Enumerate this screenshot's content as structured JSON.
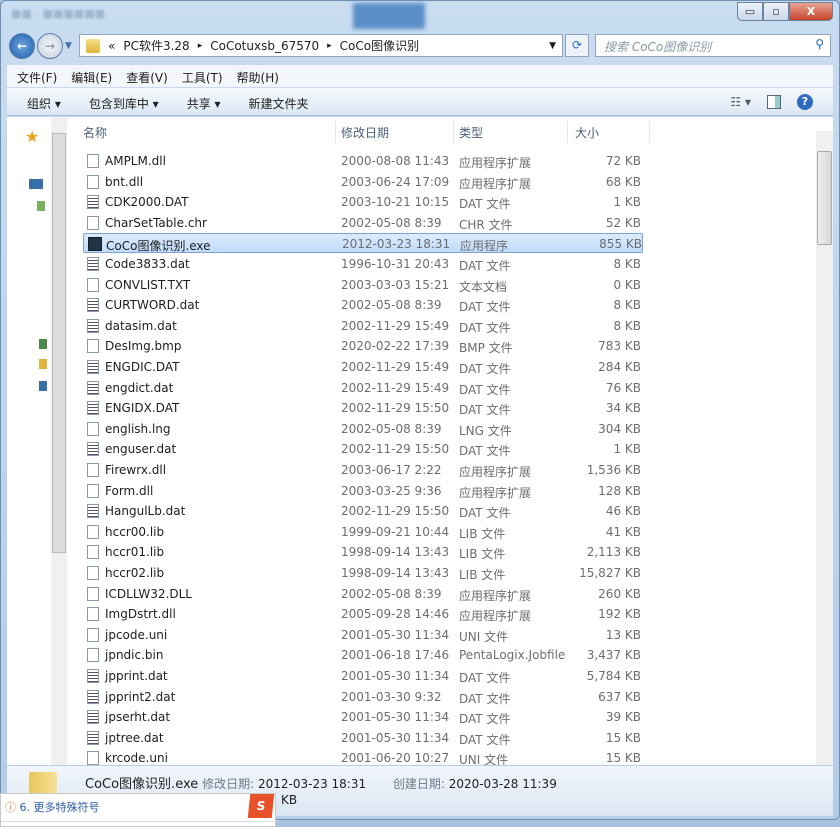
{
  "window": {
    "title_buttons": {
      "minimize": "▭",
      "maximize": "▫",
      "close": "X"
    }
  },
  "address": {
    "prefix": "«",
    "crumbs": [
      "PC软件3.28",
      "CoCotuxsb_67570",
      "CoCo图像识别"
    ],
    "separator": "▸"
  },
  "search": {
    "placeholder": "搜索 CoCo图像识别"
  },
  "menu": [
    "文件(F)",
    "编辑(E)",
    "查看(V)",
    "工具(T)",
    "帮助(H)"
  ],
  "toolbar": {
    "organize": "组织 ▾",
    "include": "包含到库中 ▾",
    "share": "共享 ▾",
    "new_folder": "新建文件夹",
    "help": "?"
  },
  "columns": {
    "name": "名称",
    "date": "修改日期",
    "type": "类型",
    "size": "大小"
  },
  "files": [
    {
      "name": "AMPLM.dll",
      "date": "2000-08-08 11:43",
      "type": "应用程序扩展",
      "size": "72 KB",
      "icon": "dll"
    },
    {
      "name": "bnt.dll",
      "date": "2003-06-24 17:09",
      "type": "应用程序扩展",
      "size": "68 KB",
      "icon": "dll"
    },
    {
      "name": "CDK2000.DAT",
      "date": "2003-10-21 10:15",
      "type": "DAT 文件",
      "size": "1 KB",
      "icon": "dat"
    },
    {
      "name": "CharSetTable.chr",
      "date": "2002-05-08 8:39",
      "type": "CHR 文件",
      "size": "52 KB",
      "icon": "file"
    },
    {
      "name": "CoCo图像识别.exe",
      "date": "2012-03-23 18:31",
      "type": "应用程序",
      "size": "855 KB",
      "icon": "exe",
      "selected": true
    },
    {
      "name": "Code3833.dat",
      "date": "1996-10-31 20:43",
      "type": "DAT 文件",
      "size": "8 KB",
      "icon": "dat"
    },
    {
      "name": "CONVLIST.TXT",
      "date": "2003-03-03 15:21",
      "type": "文本文档",
      "size": "0 KB",
      "icon": "file"
    },
    {
      "name": "CURTWORD.dat",
      "date": "2002-05-08 8:39",
      "type": "DAT 文件",
      "size": "8 KB",
      "icon": "dat"
    },
    {
      "name": "datasim.dat",
      "date": "2002-11-29 15:49",
      "type": "DAT 文件",
      "size": "8 KB",
      "icon": "dat"
    },
    {
      "name": "DesImg.bmp",
      "date": "2020-02-22 17:39",
      "type": "BMP 文件",
      "size": "783 KB",
      "icon": "file"
    },
    {
      "name": "ENGDIC.DAT",
      "date": "2002-11-29 15:49",
      "type": "DAT 文件",
      "size": "284 KB",
      "icon": "dat"
    },
    {
      "name": "engdict.dat",
      "date": "2002-11-29 15:49",
      "type": "DAT 文件",
      "size": "76 KB",
      "icon": "dat"
    },
    {
      "name": "ENGIDX.DAT",
      "date": "2002-11-29 15:50",
      "type": "DAT 文件",
      "size": "34 KB",
      "icon": "dat"
    },
    {
      "name": "english.lng",
      "date": "2002-05-08 8:39",
      "type": "LNG 文件",
      "size": "304 KB",
      "icon": "file"
    },
    {
      "name": "enguser.dat",
      "date": "2002-11-29 15:50",
      "type": "DAT 文件",
      "size": "1 KB",
      "icon": "dat"
    },
    {
      "name": "Firewrx.dll",
      "date": "2003-06-17 2:22",
      "type": "应用程序扩展",
      "size": "1,536 KB",
      "icon": "dll"
    },
    {
      "name": "Form.dll",
      "date": "2003-03-25 9:36",
      "type": "应用程序扩展",
      "size": "128 KB",
      "icon": "dll"
    },
    {
      "name": "HangulLb.dat",
      "date": "2002-11-29 15:50",
      "type": "DAT 文件",
      "size": "46 KB",
      "icon": "dat"
    },
    {
      "name": "hccr00.lib",
      "date": "1999-09-21 10:44",
      "type": "LIB 文件",
      "size": "41 KB",
      "icon": "file"
    },
    {
      "name": "hccr01.lib",
      "date": "1998-09-14 13:43",
      "type": "LIB 文件",
      "size": "2,113 KB",
      "icon": "file"
    },
    {
      "name": "hccr02.lib",
      "date": "1998-09-14 13:43",
      "type": "LIB 文件",
      "size": "15,827 KB",
      "icon": "file"
    },
    {
      "name": "ICDLLW32.DLL",
      "date": "2002-05-08 8:39",
      "type": "应用程序扩展",
      "size": "260 KB",
      "icon": "dll"
    },
    {
      "name": "ImgDstrt.dll",
      "date": "2005-09-28 14:46",
      "type": "应用程序扩展",
      "size": "192 KB",
      "icon": "dll"
    },
    {
      "name": "jpcode.uni",
      "date": "2001-05-30 11:34",
      "type": "UNI 文件",
      "size": "13 KB",
      "icon": "file"
    },
    {
      "name": "jpndic.bin",
      "date": "2001-06-18 17:46",
      "type": "PentaLogix.Jobfile",
      "size": "3,437 KB",
      "icon": "file"
    },
    {
      "name": "jpprint.dat",
      "date": "2001-05-30 11:34",
      "type": "DAT 文件",
      "size": "5,784 KB",
      "icon": "dat"
    },
    {
      "name": "jpprint2.dat",
      "date": "2001-03-30 9:32",
      "type": "DAT 文件",
      "size": "637 KB",
      "icon": "dat"
    },
    {
      "name": "jpserht.dat",
      "date": "2001-05-30 11:34",
      "type": "DAT 文件",
      "size": "39 KB",
      "icon": "dat"
    },
    {
      "name": "jptree.dat",
      "date": "2001-05-30 11:34",
      "type": "DAT 文件",
      "size": "15 KB",
      "icon": "dat"
    },
    {
      "name": "krcode.uni",
      "date": "2001-06-20 10:27",
      "type": "UNI 文件",
      "size": "15 KB",
      "icon": "file"
    }
  ],
  "status": {
    "name": "CoCo图像识别.exe",
    "modified_label": "修改日期:",
    "modified": "2012-03-23 18:31",
    "created_label": "创建日期:",
    "created": "2020-03-28 11:39",
    "size": "KB"
  },
  "ime": {
    "suggestion": "6. 更多特殊符号",
    "logo": "S"
  }
}
